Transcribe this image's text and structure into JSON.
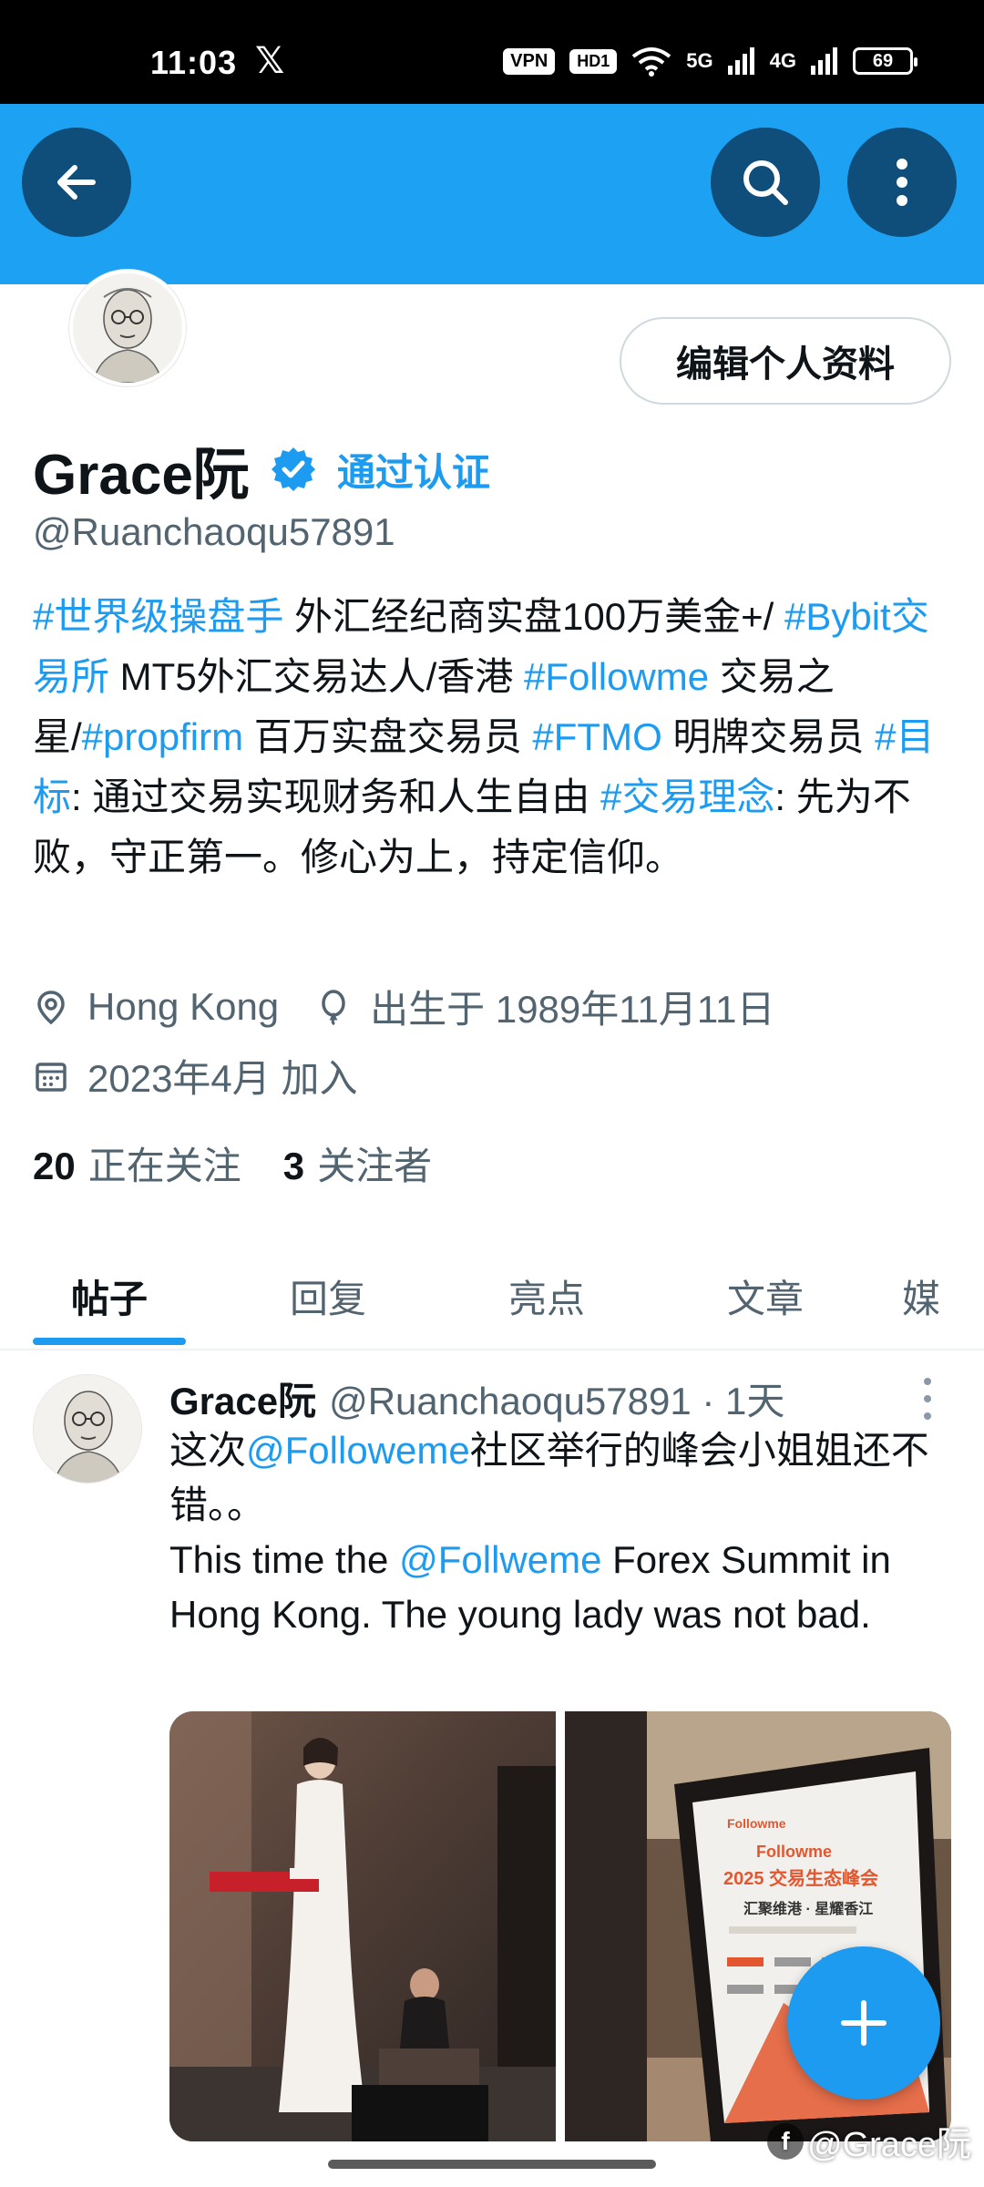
{
  "status_bar": {
    "time": "11:03",
    "x_logo": "𝕏",
    "vpn": "VPN",
    "hd": "HD1",
    "net1": "5G",
    "net2": "4G",
    "battery": "69"
  },
  "header": {
    "back_icon": "arrow-left-icon",
    "search_icon": "search-icon",
    "more_icon": "more-vertical-icon",
    "banner_color": "#1da1f2"
  },
  "profile": {
    "edit_button": "编辑个人资料",
    "name": "Grace阮",
    "verified_label": "通过认证",
    "handle": "@Ruanchaoqu57891",
    "bio": [
      {
        "t": "#世界级操盘手",
        "tag": true
      },
      {
        "t": " 外汇经纪商实盘100万美金+/ ",
        "tag": false
      },
      {
        "t": "#Bybit交易所",
        "tag": true
      },
      {
        "t": " MT5外汇交易达人/香港 ",
        "tag": false
      },
      {
        "t": "#Followme",
        "tag": true
      },
      {
        "t": " 交易之星/",
        "tag": false
      },
      {
        "t": "#propfirm",
        "tag": true
      },
      {
        "t": " 百万实盘交易员 ",
        "tag": false
      },
      {
        "t": "#FTMO",
        "tag": true
      },
      {
        "t": " 明牌交易员  ",
        "tag": false
      },
      {
        "t": "#目标",
        "tag": true
      },
      {
        "t": ": 通过交易实现财务和人生自由    ",
        "tag": false
      },
      {
        "t": "#交易理念",
        "tag": true
      },
      {
        "t": ": 先为不败，守正第一。修心为上，持定信仰。",
        "tag": false
      }
    ],
    "location": "Hong Kong",
    "birthday": "出生于 1989年11月11日",
    "joined": "2023年4月 加入",
    "following_count": "20",
    "following_label": "正在关注",
    "followers_count": "3",
    "followers_label": "关注者"
  },
  "tabs": [
    {
      "label": "帖子",
      "active": true
    },
    {
      "label": "回复",
      "active": false
    },
    {
      "label": "亮点",
      "active": false
    },
    {
      "label": "文章",
      "active": false
    },
    {
      "label": "媒",
      "active": false
    }
  ],
  "tweet": {
    "name": "Grace阮",
    "handle_time": "@Ruanchaoqu57891 · 1天",
    "line1_pre": "这次",
    "line1_mention": "@Followeme",
    "line1_post": "社区举行的峰会小姐姐还不错。。",
    "line2_pre": "This time the ",
    "line2_mention": "@Follweme",
    "line2_post": " Forex Summit in Hong Kong. The young lady was not bad.",
    "poster_brand": "Followme",
    "poster_title1": "Followme",
    "poster_title2": "2025 交易生态峰会",
    "poster_sub": "汇聚维港 · 星耀香江"
  },
  "fab_icon": "plus-icon",
  "watermark": "@Grace阮"
}
